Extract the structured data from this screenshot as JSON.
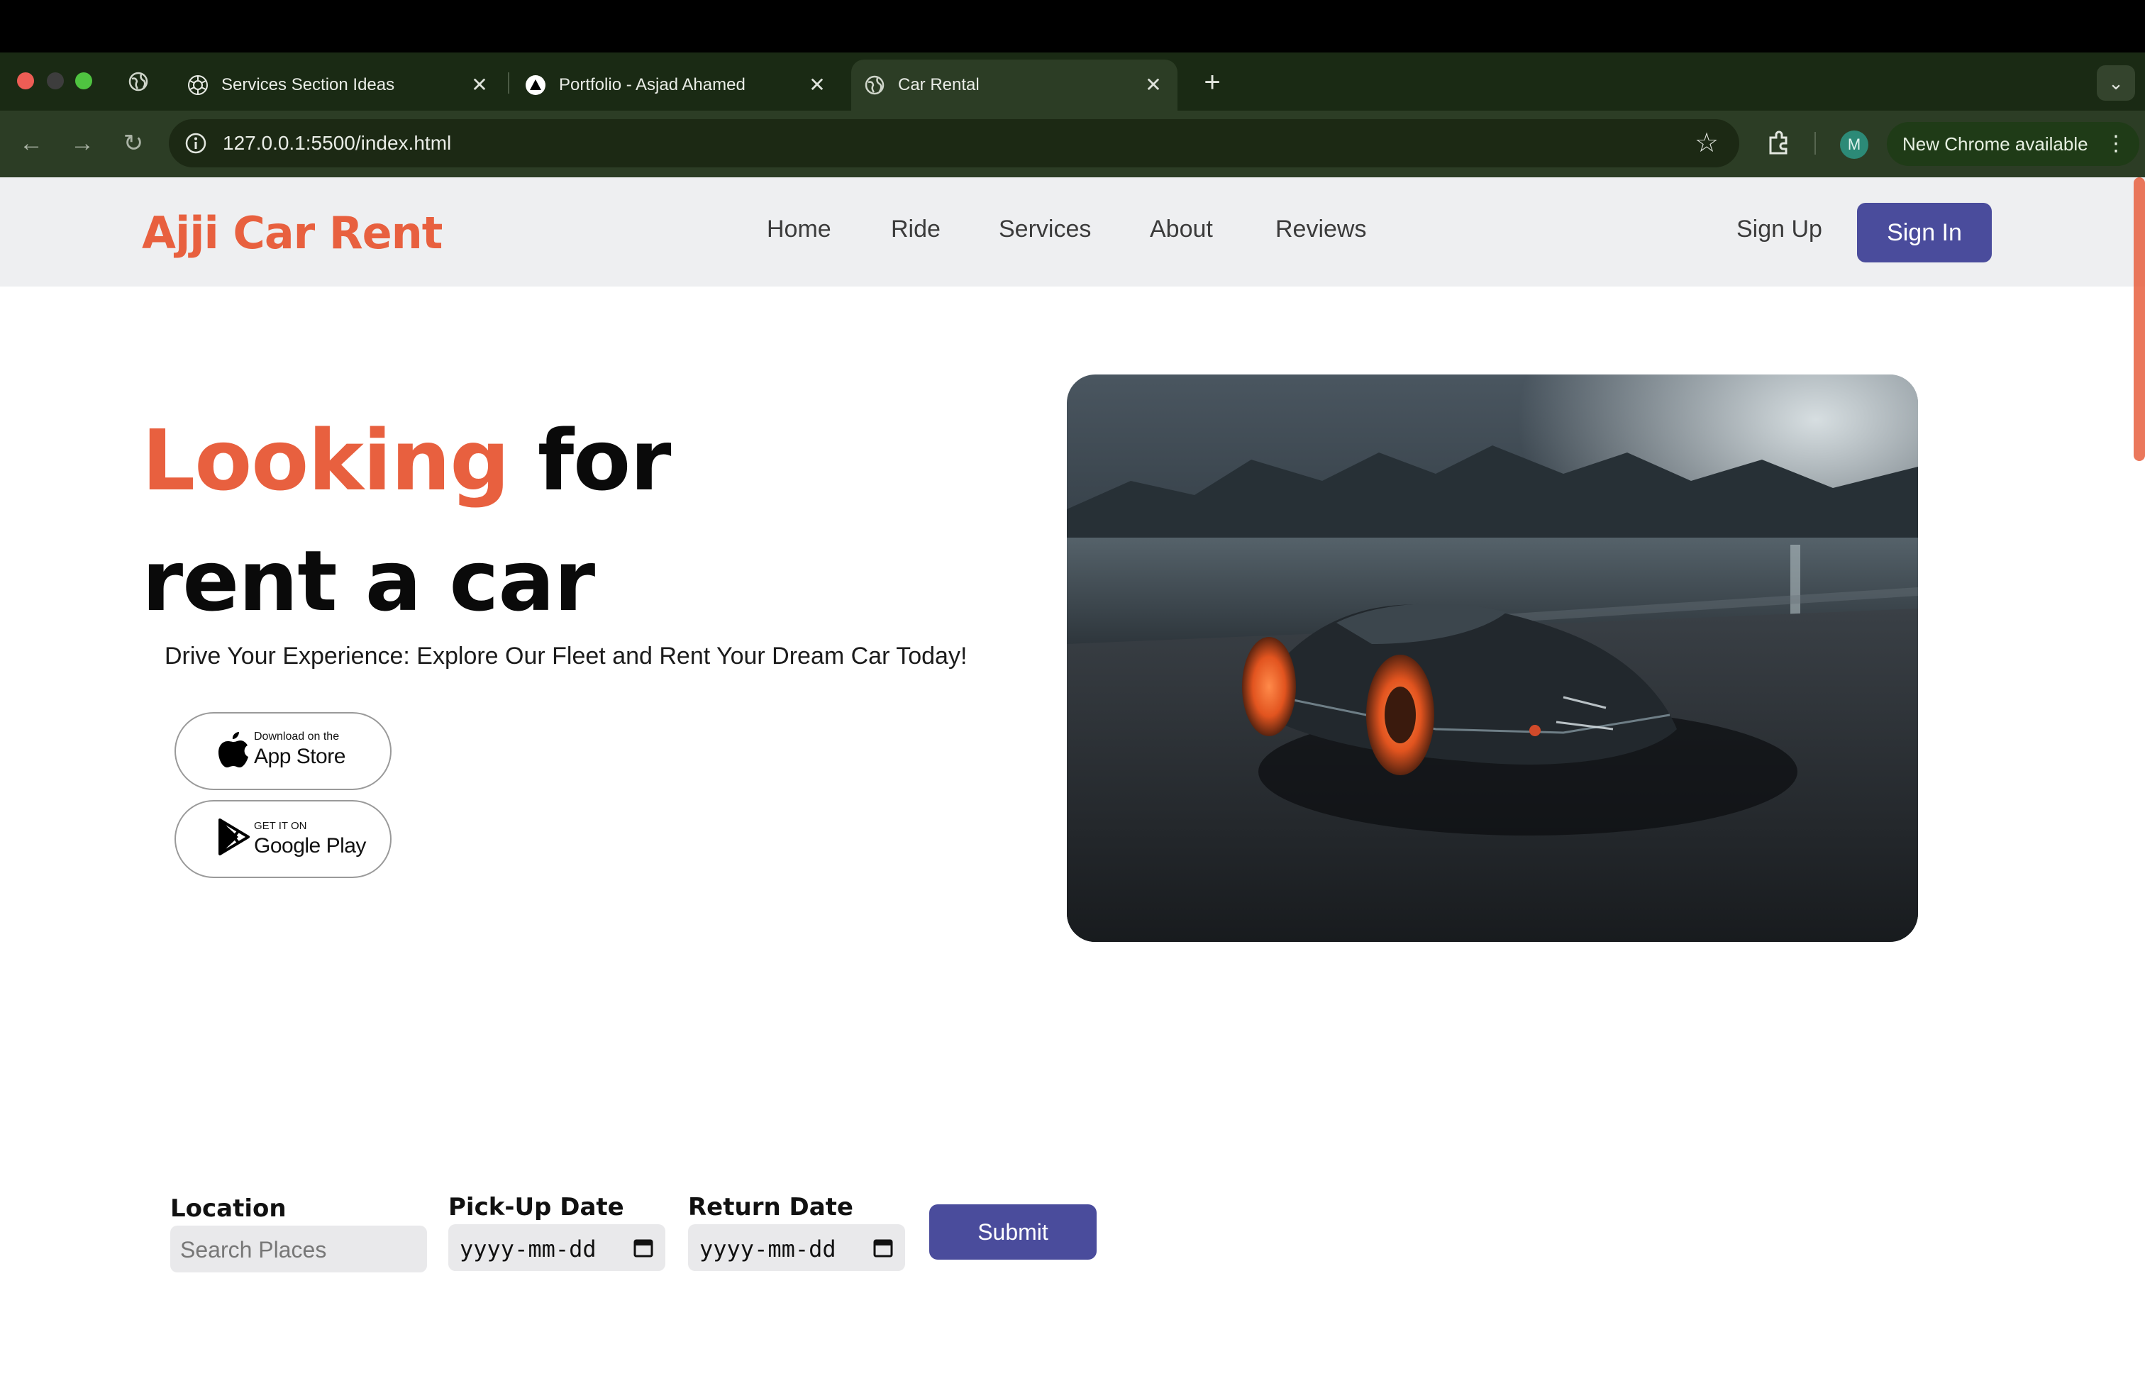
{
  "browser": {
    "tabs": [
      {
        "title": "Services Section Ideas",
        "icon": "openai-icon"
      },
      {
        "title": "Portfolio - Asjad Ahamed",
        "icon": "triangle-icon"
      },
      {
        "title": "Car Rental",
        "icon": "globe-icon",
        "active": true
      }
    ],
    "url": "127.0.0.1:5500/index.html",
    "profile_initial": "M",
    "update_label": "New Chrome available"
  },
  "site": {
    "brand": "Ajji Car Rent",
    "nav": [
      "Home",
      "Ride",
      "Services",
      "About",
      "Reviews"
    ],
    "signup_label": "Sign Up",
    "signin_label": "Sign In"
  },
  "hero": {
    "title_accent": "Looking",
    "title_rest_line1": " for",
    "title_line2": "rent a car",
    "subtitle": "Drive Your Experience: Explore Our Fleet and Rent Your Dream Car Today!",
    "appstore": {
      "small": "Download on the",
      "big": "App Store"
    },
    "googleplay": {
      "small": "GET IT ON",
      "big": "Google Play"
    },
    "image_alt": "dark sports car on wet pavement"
  },
  "booking": {
    "location_label": "Location",
    "location_placeholder": "Search Places",
    "pickup_label": "Pick-Up Date",
    "pickup_value": "yyyy-mm-dd",
    "return_label": "Return Date",
    "return_value": "yyyy-mm-dd",
    "submit_label": "Submit"
  },
  "colors": {
    "accent": "#e8603f",
    "button": "#4a4c9c",
    "header_bg": "#eeeff1"
  }
}
